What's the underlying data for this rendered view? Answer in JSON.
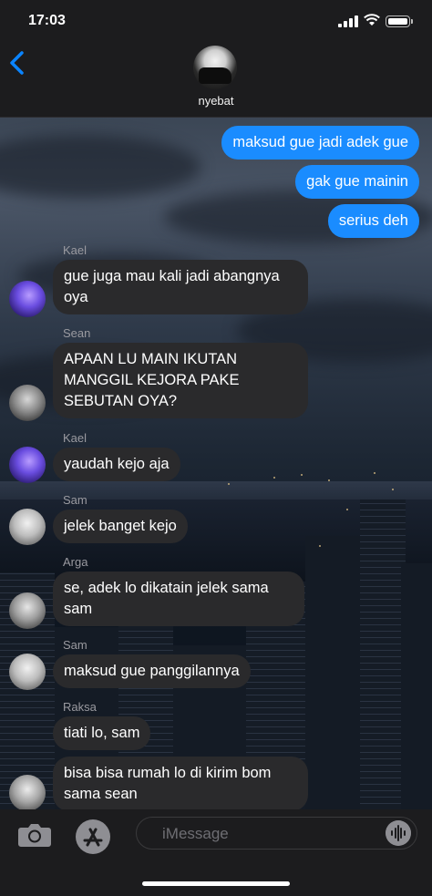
{
  "status": {
    "time": "17:03"
  },
  "header": {
    "name": "nyebat"
  },
  "messages": [
    {
      "dir": "out",
      "text": "maksud gue jadi adek gue"
    },
    {
      "dir": "out",
      "text": "gak gue mainin"
    },
    {
      "dir": "out",
      "text": "serius deh"
    },
    {
      "dir": "in",
      "sender": "Kael",
      "text": "gue juga mau kali jadi abangnya oya"
    },
    {
      "dir": "in",
      "sender": "Sean",
      "text": "APAAN LU MAIN IKUTAN MANGGIL KEJORA PAKE SEBUTAN OYA?"
    },
    {
      "dir": "in",
      "sender": "Kael",
      "text": "yaudah kejo aja"
    },
    {
      "dir": "in",
      "sender": "Sam",
      "text": "jelek banget kejo"
    },
    {
      "dir": "in",
      "sender": "Arga",
      "text": "se, adek lo dikatain jelek sama sam"
    },
    {
      "dir": "in",
      "sender": "Sam",
      "text": "maksud gue panggilannya"
    },
    {
      "dir": "in",
      "sender": "Raksa",
      "text": "tiati lo, sam"
    },
    {
      "dir": "in",
      "sender": "",
      "text": "bisa bisa rumah lo di kirim bom sama sean"
    }
  ],
  "input": {
    "placeholder": "iMessage"
  },
  "colors": {
    "outgoing": "#1a8cff",
    "incoming": "#2a2a2c",
    "accent": "#0a84ff"
  },
  "icons": [
    "back-chevron-icon",
    "camera-icon",
    "app-store-icon",
    "audio-waveform-icon",
    "signal-icon",
    "wifi-icon",
    "battery-icon"
  ]
}
